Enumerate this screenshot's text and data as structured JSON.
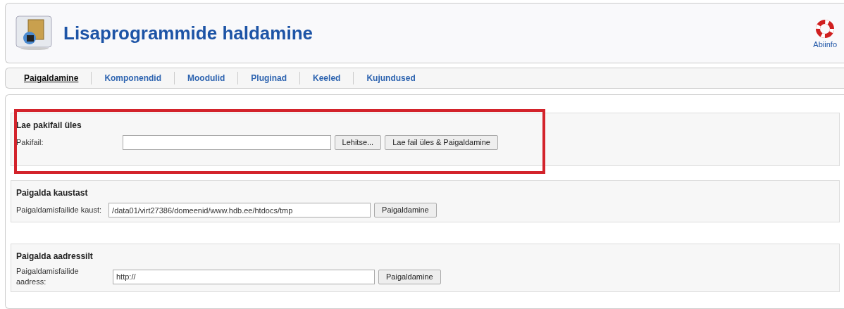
{
  "header": {
    "title": "Lisaprogrammide haldamine",
    "help": "Abiinfo"
  },
  "tabs": [
    {
      "label": "Paigaldamine",
      "selected": true
    },
    {
      "label": "Komponendid",
      "selected": false
    },
    {
      "label": "Moodulid",
      "selected": false
    },
    {
      "label": "Pluginad",
      "selected": false
    },
    {
      "label": "Keeled",
      "selected": false
    },
    {
      "label": "Kujundused",
      "selected": false
    }
  ],
  "sections": [
    {
      "title": "Lae pakifail üles",
      "highlighted": true,
      "label": "Pakifail:",
      "buttons": [
        "Lehitse...",
        "Lae fail üles & Paigaldamine"
      ]
    },
    {
      "title": "Paigalda kaustast",
      "highlighted": false,
      "label": "Paigaldamisfailide kaust:",
      "value": "/data01/virt27386/domeenid/www.hdb.ee/htdocs/tmp",
      "buttons": [
        "Paigaldamine"
      ]
    },
    {
      "title": "Paigalda aadressilt",
      "highlighted": false,
      "label": "Paigaldamisfailide aadress:",
      "value": "http://",
      "buttons": [
        "Paigaldamine"
      ]
    }
  ]
}
